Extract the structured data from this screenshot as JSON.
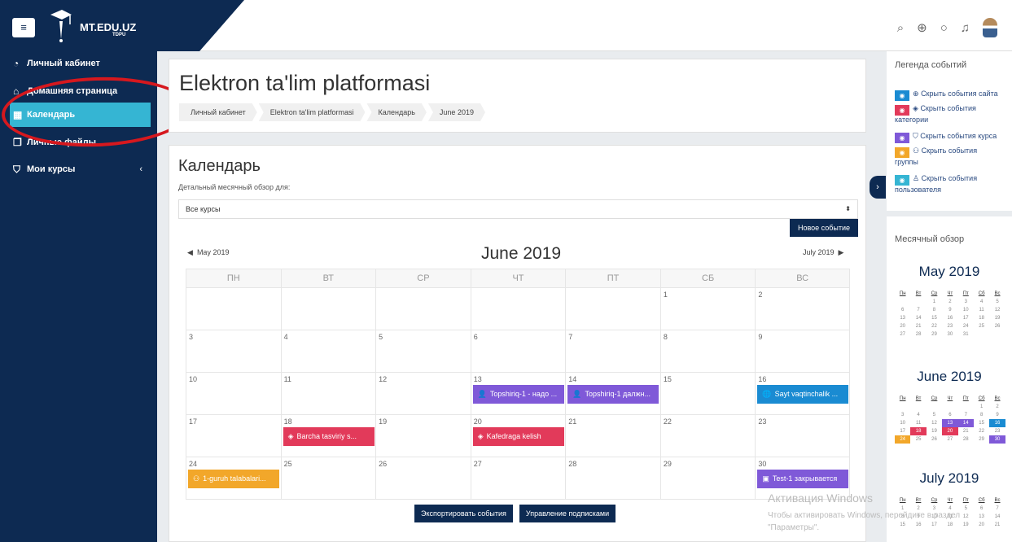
{
  "brand": {
    "name": "MT.EDU.UZ",
    "sub": "TDPU"
  },
  "sidebar": {
    "items": [
      {
        "label": "Личный кабинет",
        "icon": "dashboard-icon"
      },
      {
        "label": "Домашняя страница",
        "icon": "home-icon"
      },
      {
        "label": "Календарь",
        "icon": "calendar-icon",
        "active": true
      },
      {
        "label": "Личные файлы",
        "icon": "file-icon"
      },
      {
        "label": "Мои курсы",
        "icon": "graduation-cap-icon",
        "chevron": "‹"
      }
    ]
  },
  "header": {
    "title": "Elektron ta'lim platformasi",
    "breadcrumbs": [
      "Личный кабинет",
      "Elektron ta'lim platformasi",
      "Календарь",
      "June 2019"
    ]
  },
  "calendar": {
    "title": "Календарь",
    "subtitle": "Детальный месячный обзор для:",
    "course_select": "Все курсы",
    "new_event": "Новое событие",
    "prev_month": "May 2019",
    "next_month": "July 2019",
    "month_title": "June 2019",
    "weekdays": [
      "ПН",
      "ВТ",
      "СР",
      "ЧТ",
      "ПТ",
      "СБ",
      "ВС"
    ],
    "weeks": [
      [
        "",
        "",
        "",
        "",
        "",
        "1",
        "2"
      ],
      [
        "3",
        "4",
        "5",
        "6",
        "7",
        "8",
        "9"
      ],
      [
        "10",
        "11",
        "12",
        "13",
        "14",
        "15",
        "16"
      ],
      [
        "17",
        "18",
        "19",
        "20",
        "21",
        "22",
        "23"
      ],
      [
        "24",
        "25",
        "26",
        "27",
        "28",
        "29",
        "30"
      ]
    ],
    "events": {
      "13": {
        "label": "Topshiriq-1 - надо ...",
        "color": "#7f59d8",
        "icon": "👤"
      },
      "14": {
        "label": "Topshiriq-1 далжн...",
        "color": "#7f59d8",
        "icon": "👤"
      },
      "16": {
        "label": "Sayt vaqtinchalik ...",
        "color": "#1a8bd2",
        "icon": "🌐"
      },
      "18": {
        "label": "Barcha tasviriy s...",
        "color": "#e23a5a",
        "icon": "◈"
      },
      "20": {
        "label": "Kafedraga kelish",
        "color": "#e23a5a",
        "icon": "◈"
      },
      "24": {
        "label": "1-guruh talabalari...",
        "color": "#f2a72a",
        "icon": "⚇"
      },
      "30": {
        "label": "Test-1 закрывается",
        "color": "#7f59d8",
        "icon": "▣"
      }
    },
    "export_button": "Экспортировать события",
    "subscriptions_button": "Управление подписками"
  },
  "legend": {
    "title": "Легенда событий",
    "items": [
      {
        "label": "Скрыть события сайта",
        "color": "#1a8bd2"
      },
      {
        "label": "Скрыть события",
        "tail": "категории",
        "color": "#e23a5a"
      },
      {
        "label": "Скрыть события курса",
        "color": "#7f59d8"
      },
      {
        "label": "Скрыть события",
        "tail": "группы",
        "color": "#f2a72a"
      },
      {
        "label": "Скрыть события",
        "tail": "пользователя",
        "color": "#35b5d3"
      }
    ]
  },
  "mini": {
    "title": "Месячный обзор",
    "weekday_short": [
      "Пн",
      "Вт",
      "Ср",
      "Чт",
      "Пт",
      "Сб",
      "Вс"
    ],
    "months": [
      {
        "name": "May 2019",
        "weeks": [
          [
            "",
            "",
            "1",
            "2",
            "3",
            "4",
            "5"
          ],
          [
            "6",
            "7",
            "8",
            "9",
            "10",
            "11",
            "12"
          ],
          [
            "13",
            "14",
            "15",
            "16",
            "17",
            "18",
            "19"
          ],
          [
            "20",
            "21",
            "22",
            "23",
            "24",
            "25",
            "26"
          ],
          [
            "27",
            "28",
            "29",
            "30",
            "31",
            "",
            ""
          ]
        ]
      },
      {
        "name": "June 2019",
        "weeks": [
          [
            "",
            "",
            "",
            "",
            "",
            "1",
            "2"
          ],
          [
            "3",
            "4",
            "5",
            "6",
            "7",
            "8",
            "9"
          ],
          [
            "10",
            "11",
            "12",
            "13",
            "14",
            "15",
            "16"
          ],
          [
            "17",
            "18",
            "19",
            "20",
            "21",
            "22",
            "23"
          ],
          [
            "24",
            "25",
            "26",
            "27",
            "28",
            "29",
            "30"
          ]
        ]
      },
      {
        "name": "July 2019",
        "weeks": [
          [
            "1",
            "2",
            "3",
            "4",
            "5",
            "6",
            "7"
          ],
          [
            "8",
            "9",
            "10",
            "11",
            "12",
            "13",
            "14"
          ],
          [
            "15",
            "16",
            "17",
            "18",
            "19",
            "20",
            "21"
          ]
        ]
      }
    ]
  },
  "watermark": {
    "line1": "Активация Windows",
    "line2": "Чтобы активировать Windows, перейдите в раздел",
    "line3": "\"Параметры\"."
  }
}
